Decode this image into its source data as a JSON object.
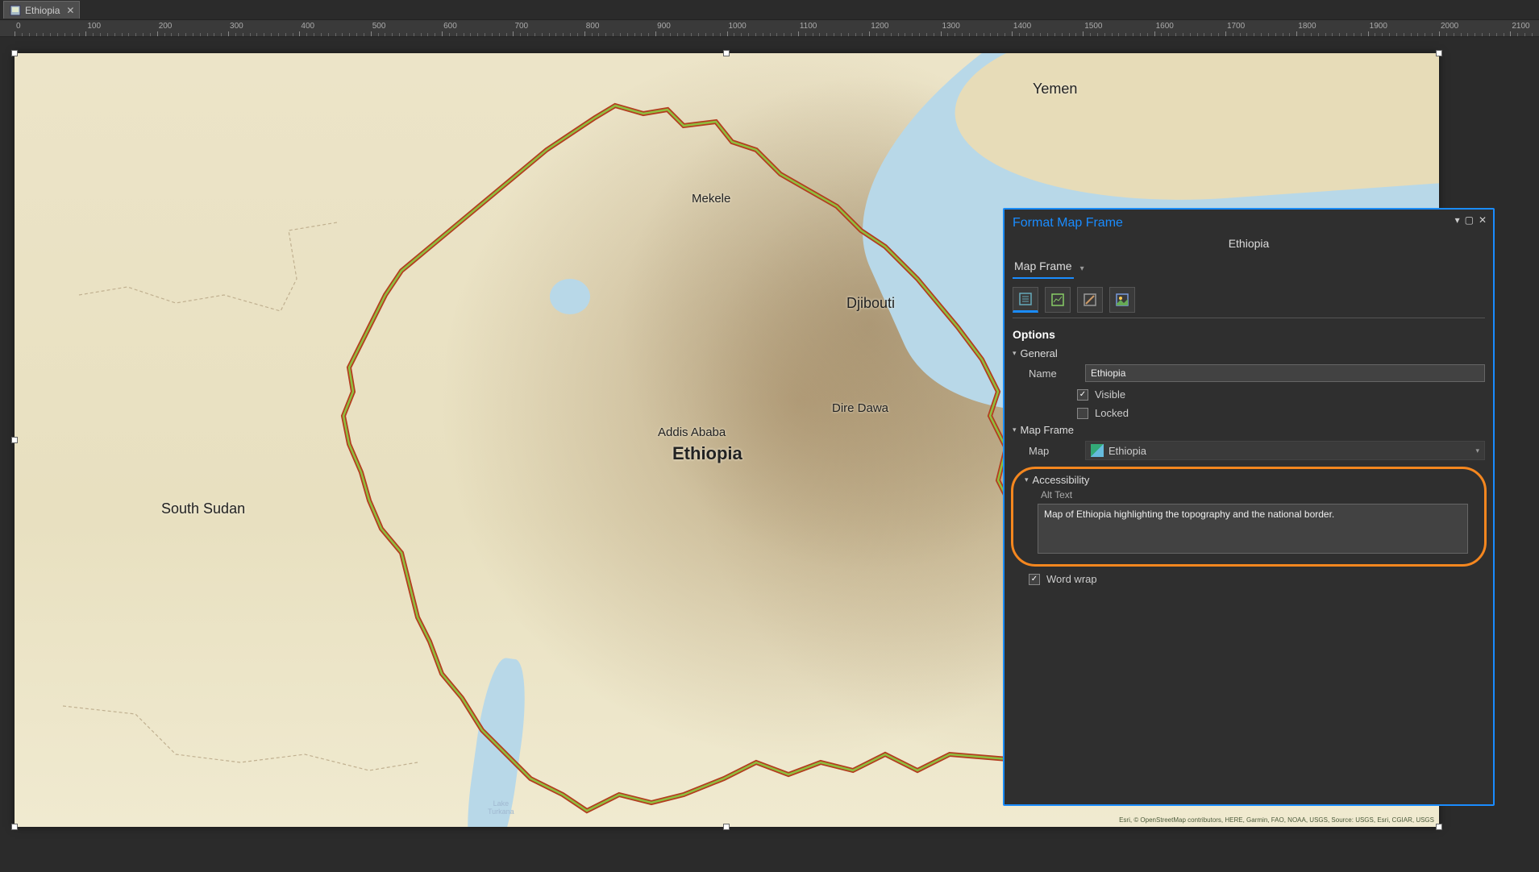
{
  "tab": {
    "label": "Ethiopia"
  },
  "ruler": {
    "start": 0,
    "step": 100,
    "count": 21
  },
  "map": {
    "labels": {
      "yemen": "Yemen",
      "djibouti": "Djibouti",
      "dire_dawa": "Dire Dawa",
      "addis": "Addis Ababa",
      "ethiopia": "Ethiopia",
      "mekele": "Mekele",
      "south_sudan": "South Sudan",
      "lake": "Lake\nTurkana"
    },
    "attribution": "Esri, © OpenStreetMap contributors, HERE, Garmin, FAO, NOAA, USGS, Source: USGS, Esri, CGIAR, USGS"
  },
  "panel": {
    "title": "Format Map Frame",
    "subtitle": "Ethiopia",
    "nav": "Map Frame",
    "options_hd": "Options",
    "general_hd": "General",
    "name_label": "Name",
    "name_value": "Ethiopia",
    "visible_label": "Visible",
    "visible_checked": true,
    "locked_label": "Locked",
    "locked_checked": false,
    "mapframe_hd": "Map Frame",
    "map_label": "Map",
    "map_value": "Ethiopia",
    "accessibility_hd": "Accessibility",
    "alttext_label": "Alt Text",
    "alttext_value": "Map of Ethiopia highlighting the topography and the national border.",
    "wordwrap_label": "Word wrap",
    "wordwrap_checked": true
  }
}
